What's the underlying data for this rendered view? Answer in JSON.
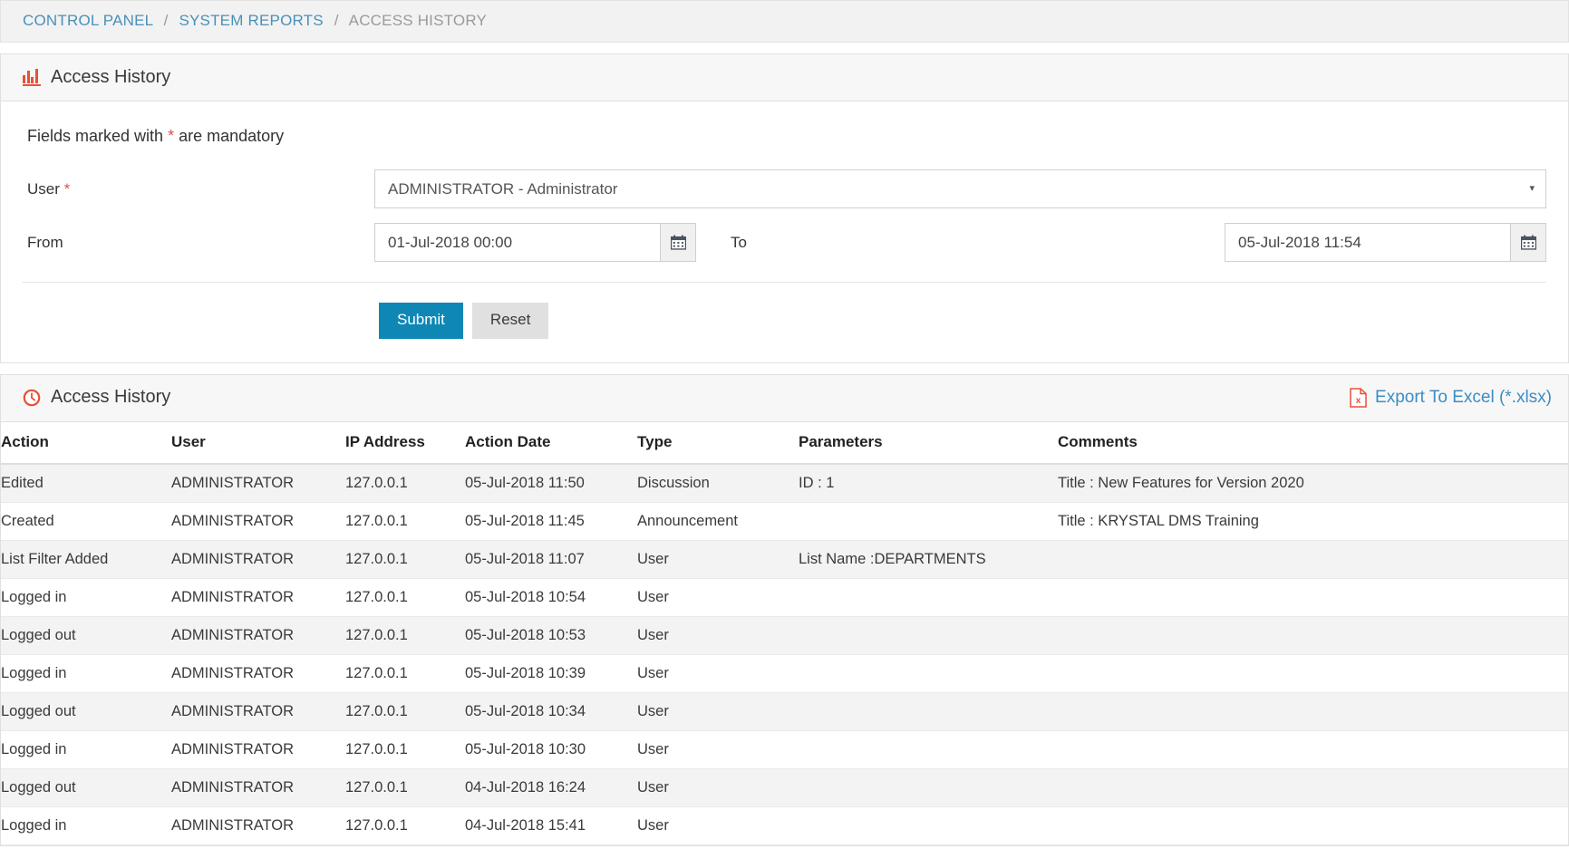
{
  "breadcrumb": {
    "items": [
      {
        "label": "CONTROL PANEL",
        "link": true
      },
      {
        "label": "SYSTEM REPORTS",
        "link": true
      },
      {
        "label": "ACCESS HISTORY",
        "link": false
      }
    ],
    "separator": "/"
  },
  "filter_panel": {
    "icon": "bar-chart-icon",
    "title": "Access History",
    "mandatory_note_before": "Fields marked with ",
    "mandatory_star": "*",
    "mandatory_note_after": " are mandatory",
    "user_label": "User",
    "user_required_star": "*",
    "user_select_value": "ADMINISTRATOR - Administrator",
    "user_select_caret": "▾",
    "from_label": "From",
    "from_value": "01-Jul-2018 00:00",
    "to_label": "To",
    "to_value": "05-Jul-2018 11:54",
    "calendar_icon": "calendar-icon",
    "submit_label": "Submit",
    "reset_label": "Reset"
  },
  "results_panel": {
    "icon": "clock-icon",
    "title": "Access History",
    "export_icon": "excel-file-icon",
    "export_label": "Export To Excel (*.xlsx)",
    "columns": [
      "Action",
      "User",
      "IP Address",
      "Action Date",
      "Type",
      "Parameters",
      "Comments"
    ],
    "rows": [
      {
        "action": "Edited",
        "user": "ADMINISTRATOR",
        "ip": "127.0.0.1",
        "date": "05-Jul-2018 11:50",
        "type": "Discussion",
        "parameters": "ID : 1",
        "comments": "Title : New Features for Version 2020"
      },
      {
        "action": "Created",
        "user": "ADMINISTRATOR",
        "ip": "127.0.0.1",
        "date": "05-Jul-2018 11:45",
        "type": "Announcement",
        "parameters": "",
        "comments": "Title : KRYSTAL DMS Training"
      },
      {
        "action": "List Filter Added",
        "user": "ADMINISTRATOR",
        "ip": "127.0.0.1",
        "date": "05-Jul-2018 11:07",
        "type": "User",
        "parameters": "List Name :DEPARTMENTS",
        "comments": ""
      },
      {
        "action": "Logged in",
        "user": "ADMINISTRATOR",
        "ip": "127.0.0.1",
        "date": "05-Jul-2018 10:54",
        "type": "User",
        "parameters": "",
        "comments": ""
      },
      {
        "action": "Logged out",
        "user": "ADMINISTRATOR",
        "ip": "127.0.0.1",
        "date": "05-Jul-2018 10:53",
        "type": "User",
        "parameters": "",
        "comments": ""
      },
      {
        "action": "Logged in",
        "user": "ADMINISTRATOR",
        "ip": "127.0.0.1",
        "date": "05-Jul-2018 10:39",
        "type": "User",
        "parameters": "",
        "comments": ""
      },
      {
        "action": "Logged out",
        "user": "ADMINISTRATOR",
        "ip": "127.0.0.1",
        "date": "05-Jul-2018 10:34",
        "type": "User",
        "parameters": "",
        "comments": ""
      },
      {
        "action": "Logged in",
        "user": "ADMINISTRATOR",
        "ip": "127.0.0.1",
        "date": "05-Jul-2018 10:30",
        "type": "User",
        "parameters": "",
        "comments": ""
      },
      {
        "action": "Logged out",
        "user": "ADMINISTRATOR",
        "ip": "127.0.0.1",
        "date": "04-Jul-2018 16:24",
        "type": "User",
        "parameters": "",
        "comments": ""
      },
      {
        "action": "Logged in",
        "user": "ADMINISTRATOR",
        "ip": "127.0.0.1",
        "date": "04-Jul-2018 15:41",
        "type": "User",
        "parameters": "",
        "comments": ""
      }
    ]
  },
  "colors": {
    "accent_blue": "#0e87b5",
    "link_blue": "#3b8dc4",
    "breadcrumb_link": "#4a90b8",
    "icon_red": "#e8503a",
    "required_red": "#d9534f",
    "row_stripe": "#f3f3f3"
  }
}
